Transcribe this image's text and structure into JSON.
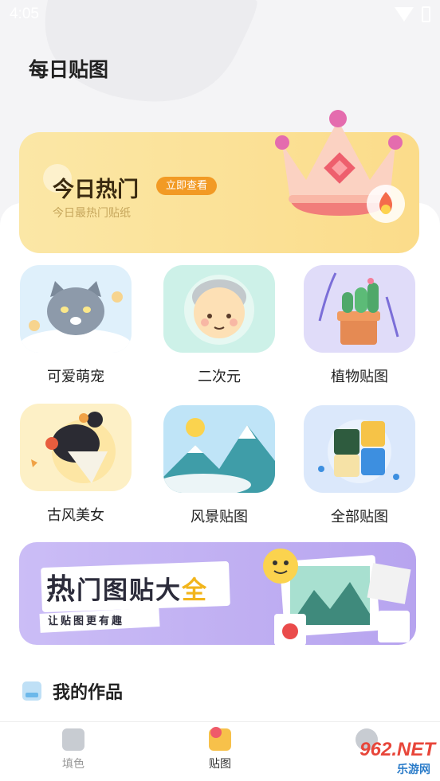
{
  "status_bar": {
    "time": "4:05"
  },
  "page": {
    "title": "每日贴图"
  },
  "hot_banner": {
    "title": "今日热门",
    "badge": "立即查看",
    "subtitle": "今日最热门贴纸"
  },
  "categories": [
    {
      "label": "可爱萌宠",
      "icon": "cat-icon"
    },
    {
      "label": "二次元",
      "icon": "anime-face-icon"
    },
    {
      "label": "植物贴图",
      "icon": "plant-icon"
    },
    {
      "label": "古风美女",
      "icon": "ancient-beauty-icon"
    },
    {
      "label": "风景贴图",
      "icon": "landscape-icon"
    },
    {
      "label": "全部贴图",
      "icon": "puzzle-icon"
    }
  ],
  "promo": {
    "title_part1": "热",
    "title_part2": "门图贴大",
    "title_part3": "全",
    "subtitle": "让贴图更有趣"
  },
  "my_works": {
    "title": "我的作品"
  },
  "bottom_nav": [
    {
      "label": "填色",
      "icon": "fill-color-icon",
      "active": false
    },
    {
      "label": "贴图",
      "icon": "sticker-icon",
      "active": true
    }
  ],
  "watermark": {
    "text": "962.NET",
    "sub": "乐游网"
  },
  "colors": {
    "accent": "#f29a24",
    "banner_yellow": "#fbe0a0",
    "promo_purple": "#c4b4f4"
  }
}
